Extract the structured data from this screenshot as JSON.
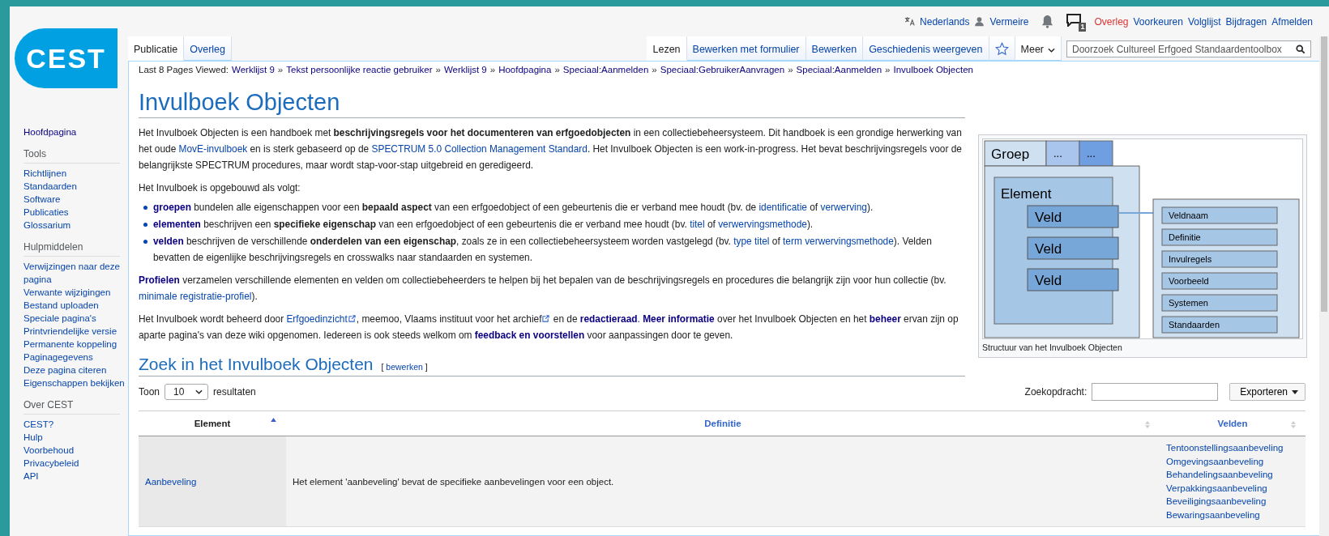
{
  "logo_text": "CEST",
  "personal_bar": {
    "language": "Nederlands",
    "user": "Vermeire",
    "notice_count": "1",
    "links": [
      {
        "label": "Overleg",
        "missing": true
      },
      {
        "label": "Voorkeuren",
        "missing": false
      },
      {
        "label": "Volglijst",
        "missing": false
      },
      {
        "label": "Bijdragen",
        "missing": false
      },
      {
        "label": "Afmelden",
        "missing": false
      }
    ]
  },
  "left_tabs": [
    {
      "label": "Publicatie",
      "selected": true
    },
    {
      "label": "Overleg",
      "selected": false
    }
  ],
  "right_tabs": [
    {
      "label": "Lezen",
      "selected": true
    },
    {
      "label": "Bewerken met formulier",
      "selected": false
    },
    {
      "label": "Bewerken",
      "selected": false
    },
    {
      "label": "Geschiedenis weergeven",
      "selected": false
    }
  ],
  "watch_starred": false,
  "more_menu": "Meer",
  "search": {
    "placeholder": "Doorzoek Cultureel Erfgoed Standaardentoolbox"
  },
  "sidebar": {
    "top": [
      {
        "label": "Hoofdpagina"
      }
    ],
    "sections": [
      {
        "heading": "Tools",
        "items": [
          {
            "label": "Richtlijnen"
          },
          {
            "label": "Standaarden"
          },
          {
            "label": "Software"
          },
          {
            "label": "Publicaties"
          },
          {
            "label": "Glossarium"
          }
        ]
      },
      {
        "heading": "Hulpmiddelen",
        "items": [
          {
            "label": "Verwijzingen naar deze pagina"
          },
          {
            "label": "Verwante wijzigingen"
          },
          {
            "label": "Bestand uploaden"
          },
          {
            "label": "Speciale pagina's"
          },
          {
            "label": "Printvriendelijke versie"
          },
          {
            "label": "Permanente koppeling"
          },
          {
            "label": "Paginagegevens"
          },
          {
            "label": "Deze pagina citeren"
          },
          {
            "label": "Eigenschappen bekijken"
          }
        ]
      },
      {
        "heading": "Over CEST",
        "items": [
          {
            "label": "CEST?"
          },
          {
            "label": "Hulp"
          },
          {
            "label": "Voorbehoud"
          },
          {
            "label": "Privacybeleid"
          },
          {
            "label": "API"
          }
        ]
      }
    ]
  },
  "breadcrumb": {
    "label": "Last 8 Pages Viewed:",
    "items": [
      {
        "label": "Werklijst 9"
      },
      {
        "label": "Tekst persoonlijke reactie gebruiker",
        "prefix": "»"
      },
      {
        "label": "Werklijst 9",
        "prefix": "»"
      },
      {
        "label": "Hoofdpagina",
        "prefix": "»"
      },
      {
        "label": "Speciaal:Aanmelden",
        "prefix": "»"
      },
      {
        "label": "Speciaal:GebruikerAanvragen",
        "prefix": "»"
      },
      {
        "label": "Speciaal:Aanmelden",
        "prefix": "»"
      },
      {
        "label": "Invulboek Objecten",
        "prefix": "»"
      }
    ]
  },
  "title": "Invulboek Objecten",
  "intro": [
    [
      {
        "kind": "text",
        "text": "Het Invulboek Objecten is een handboek met "
      },
      {
        "kind": "bold",
        "text": "beschrijvingsregels voor het documenteren van erfgoedobjecten"
      },
      {
        "kind": "text",
        "text": " in een collectiebeheersysteem. Dit handboek is een grondige herwerking van het oude "
      },
      {
        "kind": "link",
        "text": "MovE-invulboek"
      },
      {
        "kind": "text",
        "text": " en is sterk gebaseerd op de "
      },
      {
        "kind": "link",
        "text": "SPECTRUM 5.0 Collection Management Standard"
      },
      {
        "kind": "text",
        "text": ". Het Invulboek Objecten is een work-in-progress. Het bevat beschrijvingsregels voor de belangrijkste SPECTRUM procedures, maar wordt stap-voor-stap uitgebreid en geredigeerd."
      }
    ],
    [
      {
        "kind": "text",
        "text": "Het Invulboek is opgebouwd als volgt:"
      }
    ]
  ],
  "bullets": [
    [
      {
        "kind": "boldlink",
        "text": "groepen"
      },
      {
        "kind": "text",
        "text": " bundelen alle eigenschappen voor een "
      },
      {
        "kind": "bold",
        "text": "bepaald aspect"
      },
      {
        "kind": "text",
        "text": " van een erfgoedobject of een gebeurtenis die er verband mee houdt (bv. de "
      },
      {
        "kind": "link",
        "text": "identificatie"
      },
      {
        "kind": "text",
        "text": " of "
      },
      {
        "kind": "link",
        "text": "verwerving"
      },
      {
        "kind": "text",
        "text": ")."
      }
    ],
    [
      {
        "kind": "boldlink",
        "text": "elementen"
      },
      {
        "kind": "text",
        "text": " beschrijven een "
      },
      {
        "kind": "bold",
        "text": "specifieke eigenschap"
      },
      {
        "kind": "text",
        "text": " van een erfgoedobject of een gebeurtenis die er verband mee houdt (bv. "
      },
      {
        "kind": "link",
        "text": "titel"
      },
      {
        "kind": "text",
        "text": " of "
      },
      {
        "kind": "link",
        "text": "verwervingsmethode"
      },
      {
        "kind": "text",
        "text": ")."
      }
    ],
    [
      {
        "kind": "boldlink",
        "text": "velden"
      },
      {
        "kind": "text",
        "text": " beschrijven de verschillende "
      },
      {
        "kind": "bold",
        "text": "onderdelen van een eigenschap"
      },
      {
        "kind": "text",
        "text": ", zoals ze in een collectiebeheersysteem worden vastgelegd (bv. "
      },
      {
        "kind": "link",
        "text": "type titel"
      },
      {
        "kind": "text",
        "text": " of "
      },
      {
        "kind": "link",
        "text": "term verwervingsmethode"
      },
      {
        "kind": "text",
        "text": "). Velden bevatten de eigenlijke beschrijvingsregels en crosswalks naar standaarden en systemen."
      }
    ]
  ],
  "outro": [
    [
      {
        "kind": "boldlink",
        "text": "Profielen"
      },
      {
        "kind": "text",
        "text": " verzamelen verschillende elementen en velden om collectiebeheerders te helpen bij het bepalen van de beschrijvingsregels en procedures die belangrijk zijn voor hun collectie (bv. "
      },
      {
        "kind": "link",
        "text": "minimale registratie-profiel"
      },
      {
        "kind": "text",
        "text": ")."
      }
    ],
    [
      {
        "kind": "text",
        "text": "Het Invulboek wordt beheerd door "
      },
      {
        "kind": "extlink",
        "text": "Erfgoedinzicht"
      },
      {
        "kind": "text",
        "text": ", meemoo, Vlaams instituut voor het archief"
      },
      {
        "kind": "exticon"
      },
      {
        "kind": "text",
        "text": " en de "
      },
      {
        "kind": "boldlink",
        "text": "redactieraad"
      },
      {
        "kind": "text",
        "text": ". "
      },
      {
        "kind": "boldlink",
        "text": "Meer informatie"
      },
      {
        "kind": "text",
        "text": " over het Invulboek Objecten en het "
      },
      {
        "kind": "boldlink",
        "text": "beheer"
      },
      {
        "kind": "text",
        "text": " ervan zijn op aparte pagina's van deze wiki opgenomen. Iedereen is ook steeds welkom om "
      },
      {
        "kind": "boldlink",
        "text": "feedback en voorstellen"
      },
      {
        "kind": "text",
        "text": " voor aanpassingen door te geven."
      }
    ]
  ],
  "figure": {
    "group": "Groep",
    "group_more": [
      "...",
      "..."
    ],
    "element": "Element",
    "fields": [
      "Veld",
      "Veld",
      "Veld"
    ],
    "properties": [
      "Veldnaam",
      "Definitie",
      "Invulregels",
      "Voorbeeld",
      "Systemen",
      "Standaarden"
    ],
    "caption": "Structuur van het Invulboek Objecten"
  },
  "section": {
    "heading": "Zoek in het Invulboek Objecten",
    "edit_open": "[",
    "edit_link": "bewerken",
    "edit_close": "]"
  },
  "table_controls": {
    "show_label": "Toon",
    "page_size": "10",
    "show_suffix": "resultaten",
    "search_label": "Zoekopdracht:",
    "export_button": "Exporteren"
  },
  "table": {
    "columns": [
      {
        "label": "Element",
        "sorted": true
      },
      {
        "label": "Definitie",
        "sorted": false
      },
      {
        "label": "Velden",
        "sorted": false
      }
    ],
    "rows": [
      {
        "element": "Aanbeveling",
        "definition": "Het element 'aanbeveling' bevat de specifieke aanbevelingen voor een object.",
        "fields": [
          "Tentoonstellingsaanbeveling",
          "Omgevingsaanbeveling",
          "Behandelingsaanbeveling",
          "Verpakkingsaanbeveling",
          "Beveiligingsaanbeveling",
          "Bewaringsaanbeveling"
        ]
      }
    ]
  }
}
